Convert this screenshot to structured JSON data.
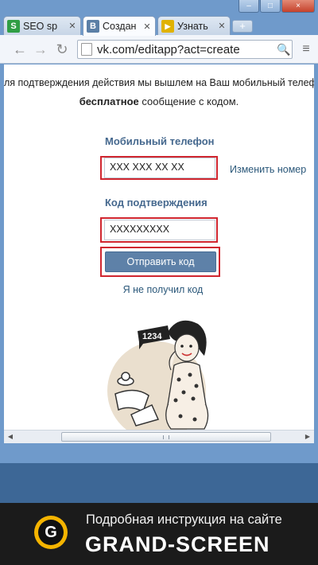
{
  "browser": {
    "tabs": [
      {
        "favicon": "S",
        "favicon_color": "#2f9e44",
        "title": "SEO sp",
        "active": false
      },
      {
        "favicon": "В",
        "favicon_color": "#5b7fa6",
        "title": "Создан",
        "active": true
      },
      {
        "favicon": "▶",
        "favicon_color": "#e0b200",
        "title": "Узнать",
        "active": false
      }
    ],
    "new_tab_symbol": "+",
    "address_bar": {
      "url": "vk.com/editapp?act=create"
    },
    "window_controls": {
      "minimize": "–",
      "maximize": "□",
      "close": "×"
    },
    "nav": {
      "back": "←",
      "forward": "→",
      "reload": "↻",
      "zoom": "🔍",
      "menu": "≡"
    }
  },
  "page": {
    "intro_line1": "ля подтверждения действия мы вышлем на Ваш мобильный телефон",
    "intro_line2_bold": "бесплатное",
    "intro_line2_rest": " сообщение с кодом.",
    "phone": {
      "label": "Мобильный телефон",
      "value": "XXX XXX XX XX",
      "change_link": "Изменить номер"
    },
    "code": {
      "label": "Код подтверждения",
      "value": "XXXXXXXXX"
    },
    "submit_label": "Отправить код",
    "not_received_link": "Я не получил код",
    "illustration": {
      "phone_number_text": "1234"
    }
  },
  "banner": {
    "logo_letter": "G",
    "line1": "Подробная инструкция на сайте",
    "line2": "GRAND-SCREEN"
  },
  "colors": {
    "vk_blue": "#45688e",
    "link": "#2b587a",
    "highlight_red": "#d0262f",
    "button": "#5e81a8",
    "banner_accent": "#f5b400"
  }
}
